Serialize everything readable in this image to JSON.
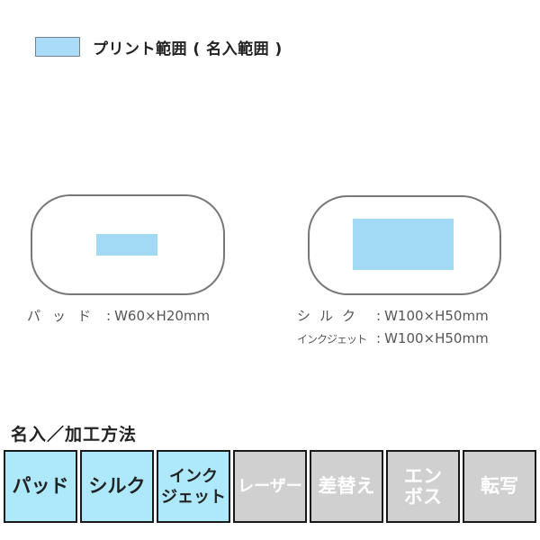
{
  "legend": {
    "label": "プリント範囲 ( 名入範囲 )",
    "swatch_color": "#abdcf7"
  },
  "products": [
    {
      "name": "left-product",
      "print_area_color": "#a2d9f5",
      "specs": [
        {
          "method": "パッド",
          "separator": ":",
          "size": "W60×H20mm"
        }
      ]
    },
    {
      "name": "right-product",
      "print_area_color": "#a2d9f5",
      "specs": [
        {
          "method": "シルク",
          "separator": ":",
          "size": "W100×H50mm"
        },
        {
          "method": "インクジェット",
          "separator": ":",
          "size": "W100×H50mm"
        }
      ]
    }
  ],
  "methods_section": {
    "title": "名入／加工方法",
    "colors": {
      "active_bg": "#aee8fb",
      "inactive_bg": "#d0d0d0"
    },
    "buttons": [
      {
        "label": "パッド",
        "active": true
      },
      {
        "label": "シルク",
        "active": true
      },
      {
        "label": "インク\nジェット",
        "active": true
      },
      {
        "label": "レーザー",
        "active": false
      },
      {
        "label": "差替え",
        "active": false
      },
      {
        "label": "エン\nボス",
        "active": false
      },
      {
        "label": "転写",
        "active": false
      }
    ]
  }
}
